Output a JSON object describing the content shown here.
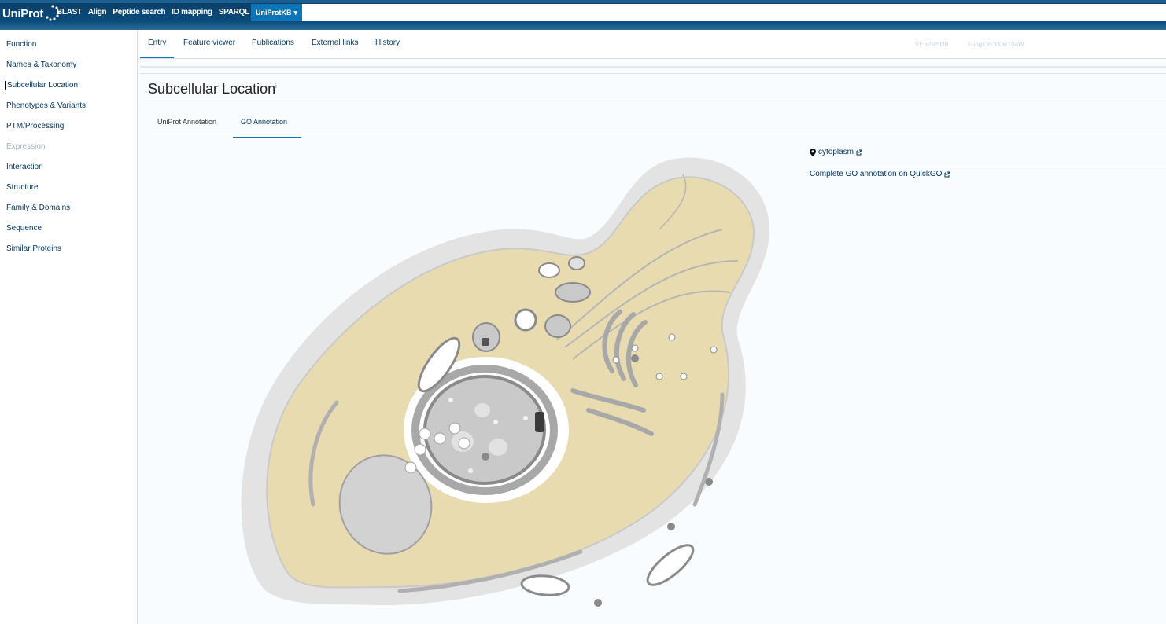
{
  "header": {
    "logo_text": "UniProt",
    "nav": [
      "BLAST",
      "Align",
      "Peptide search",
      "ID mapping",
      "SPARQL"
    ],
    "db_select": "UniProtKB",
    "search_value": ""
  },
  "sidebar": {
    "items": [
      {
        "label": "Function"
      },
      {
        "label": "Names & Taxonomy"
      },
      {
        "label": "Subcellular Location"
      },
      {
        "label": "Phenotypes & Variants"
      },
      {
        "label": "PTM/Processing"
      },
      {
        "label": "Expression"
      },
      {
        "label": "Interaction"
      },
      {
        "label": "Structure"
      },
      {
        "label": "Family & Domains"
      },
      {
        "label": "Sequence"
      },
      {
        "label": "Similar Proteins"
      }
    ]
  },
  "entry_tabs": {
    "tabs": [
      "Entry",
      "Feature viewer",
      "Publications",
      "External links",
      "History"
    ],
    "faded_links": [
      "VEuPathDB",
      "FungiDB:YOR104W"
    ]
  },
  "section": {
    "title": "Subcellular Location",
    "info_mark": "i",
    "tabs": [
      "UniProt Annotation",
      "GO Annotation"
    ]
  },
  "go": {
    "location": "cytoplasm",
    "quickgo_link": "Complete GO annotation on QuickGO"
  },
  "colors": {
    "header": "#0b3e67",
    "accent": "#0d74b5",
    "cytoplasm": "#e8dbb0"
  }
}
